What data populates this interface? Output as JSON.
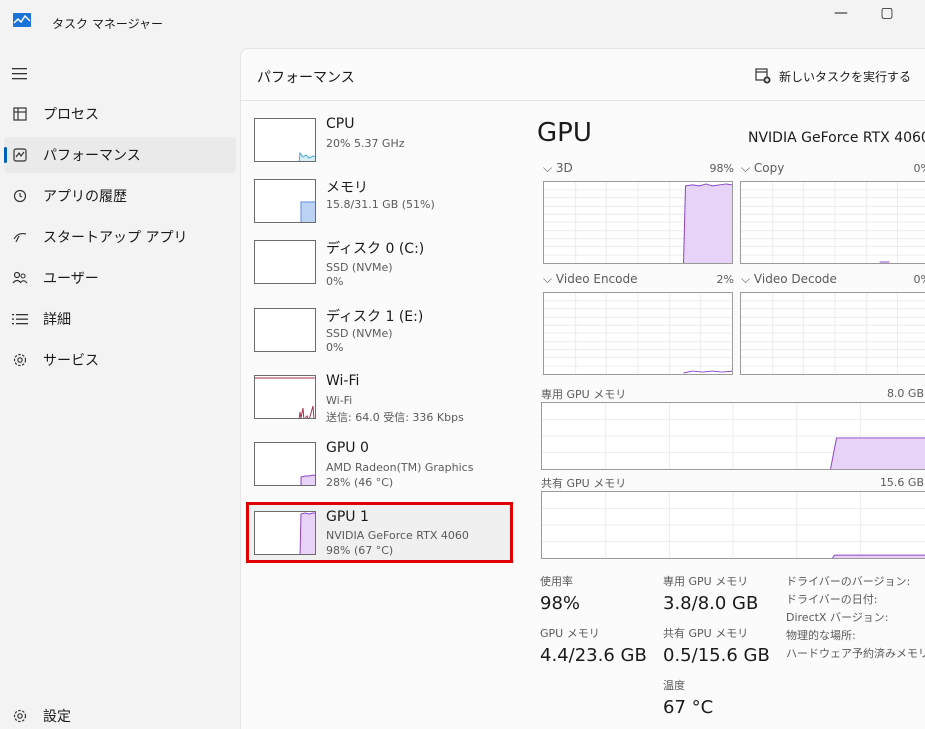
{
  "window": {
    "title": "タスク マネージャー",
    "minimize": "—",
    "maximize": "▢"
  },
  "sidebar": {
    "items": [
      {
        "label": "プロセス"
      },
      {
        "label": "パフォーマンス"
      },
      {
        "label": "アプリの履歴"
      },
      {
        "label": "スタートアップ アプリ"
      },
      {
        "label": "ユーザー"
      },
      {
        "label": "詳細"
      },
      {
        "label": "サービス"
      }
    ],
    "settings": "設定"
  },
  "header": {
    "title": "パフォーマンス",
    "new_task": "新しいタスクを実行する"
  },
  "resources": [
    {
      "name": "CPU",
      "sub1": "20%  5.37 GHz",
      "sub2": "",
      "sub3": ""
    },
    {
      "name": "メモリ",
      "sub1": "15.8/31.1 GB (51%)",
      "sub2": "",
      "sub3": ""
    },
    {
      "name": "ディスク 0 (C:)",
      "sub1": "SSD (NVMe)",
      "sub2": "0%",
      "sub3": ""
    },
    {
      "name": "ディスク 1 (E:)",
      "sub1": "SSD (NVMe)",
      "sub2": "0%",
      "sub3": ""
    },
    {
      "name": "Wi-Fi",
      "sub1": "Wi-Fi",
      "sub2": "送信: 64.0  受信: 336 Kbps",
      "sub3": ""
    },
    {
      "name": "GPU 0",
      "sub1": "AMD Radeon(TM) Graphics",
      "sub2": "28%  (46 °C)",
      "sub3": ""
    },
    {
      "name": "GPU 1",
      "sub1": "NVIDIA GeForce RTX 4060",
      "sub2": "98%  (67 °C)",
      "sub3": ""
    }
  ],
  "detail": {
    "title": "GPU",
    "model": "NVIDIA GeForce RTX 4060",
    "engines": [
      {
        "label": "3D",
        "percent": "98%"
      },
      {
        "label": "Copy",
        "percent": "0%"
      },
      {
        "label": "Video Encode",
        "percent": "2%"
      },
      {
        "label": "Video Decode",
        "percent": "0%"
      }
    ],
    "dedicated_label": "専用 GPU メモリ",
    "dedicated_max": "8.0 GB",
    "shared_label": "共有 GPU メモリ",
    "shared_max": "15.6 GB",
    "stats": {
      "usage_label": "使用率",
      "usage_value": "98%",
      "ded_label": "専用 GPU メモリ",
      "ded_value": "3.8/8.0 GB",
      "gpumem_label": "GPU メモリ",
      "gpumem_value": "4.4/23.6 GB",
      "shared_label": "共有 GPU メモリ",
      "shared_value": "0.5/15.6 GB",
      "temp_label": "温度",
      "temp_value": "67 °C"
    },
    "properties": [
      "ドライバーのバージョン:",
      "ドライバーの日付:",
      "DirectX バージョン:",
      "物理的な場所:",
      "ハードウェア予約済みメモリ:"
    ]
  },
  "colors": {
    "accent": "#005fb8",
    "gpu": "#8b42c7",
    "gpu_fill": "#e6d3f7",
    "cpu": "#4aa6c8",
    "mem": "#5b8de0",
    "wifi": "#a8324a",
    "highlight": "#e00000"
  }
}
